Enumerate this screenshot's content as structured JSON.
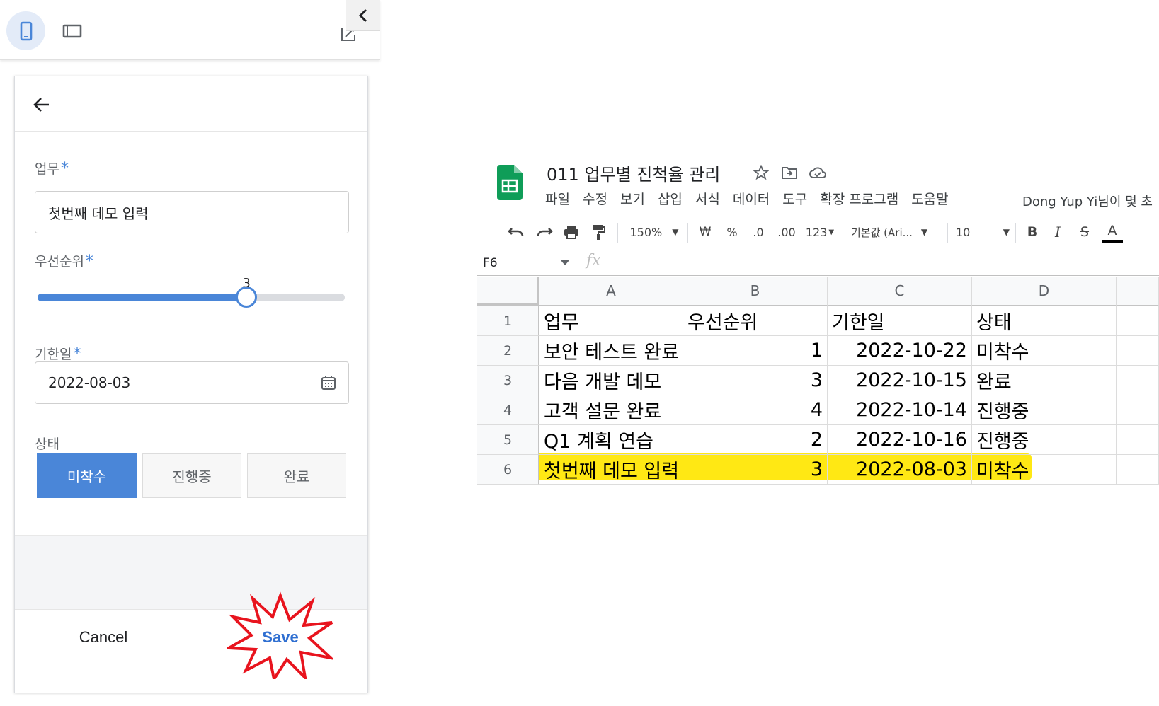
{
  "app_panel": {
    "view_toggle": {
      "phone_icon": "phone-icon",
      "tablet_icon": "tablet-icon",
      "edit_icon": "edit-icon",
      "collapse_icon": "chevron-left-icon"
    },
    "back_icon": "arrow-back-icon",
    "fields": {
      "task": {
        "label": "업무",
        "required_mark": "*",
        "value": "첫번째 데모 입력"
      },
      "priority": {
        "label": "우선순위",
        "required_mark": "*",
        "value": "3",
        "min": 1,
        "max": 4,
        "fill_fraction": 0.68
      },
      "due_date": {
        "label": "기한일",
        "required_mark": "*",
        "value": "2022-08-03",
        "icon": "calendar-icon"
      },
      "status": {
        "label": "상태",
        "options": [
          "미착수",
          "진행중",
          "완료"
        ],
        "selected": "미착수"
      }
    },
    "footer": {
      "cancel_label": "Cancel",
      "save_label": "Save"
    }
  },
  "spreadsheet": {
    "title": "011 업무별 진척율 관리",
    "title_icons": [
      "star-icon",
      "move-folder-icon",
      "cloud-icon"
    ],
    "menu": [
      "파일",
      "수정",
      "보기",
      "삽입",
      "서식",
      "데이터",
      "도구",
      "확장 프로그램",
      "도움말"
    ],
    "owner_text": "Dong Yup Yi님이 몇 초",
    "toolbar": {
      "zoom": "150%",
      "currency": "₩",
      "percent": "%",
      "dec_decrease": ".0",
      "dec_increase": ".00",
      "number_format": "123",
      "font": "기본값 (Ari...",
      "font_size": "10",
      "bold": "B",
      "italic": "I",
      "strike": "S",
      "text_color": "A"
    },
    "name_box": "F6",
    "fx": "fx",
    "columns": [
      "A",
      "B",
      "C",
      "D"
    ],
    "rows": [
      {
        "n": "1",
        "a": "업무",
        "b": "우선순위",
        "c": "기한일",
        "d": "상태"
      },
      {
        "n": "2",
        "a": "보안 테스트 완료",
        "b": "1",
        "c": "2022-10-22",
        "d": "미착수"
      },
      {
        "n": "3",
        "a": "다음 개발 데모",
        "b": "3",
        "c": "2022-10-15",
        "d": "완료"
      },
      {
        "n": "4",
        "a": "고객 설문 완료",
        "b": "4",
        "c": "2022-10-14",
        "d": "진행중"
      },
      {
        "n": "5",
        "a": "Q1 계획 연습",
        "b": "2",
        "c": "2022-10-16",
        "d": "진행중"
      },
      {
        "n": "6",
        "a": "첫번째 데모 입력",
        "b": "3",
        "c": "2022-08-03",
        "d": "미착수"
      }
    ],
    "highlight_color": "#ffe600"
  },
  "colors": {
    "accent": "#4a86d8",
    "save_text": "#2f6fd1",
    "burst": "#e8141e",
    "sheets_green": "#0f9d58"
  }
}
